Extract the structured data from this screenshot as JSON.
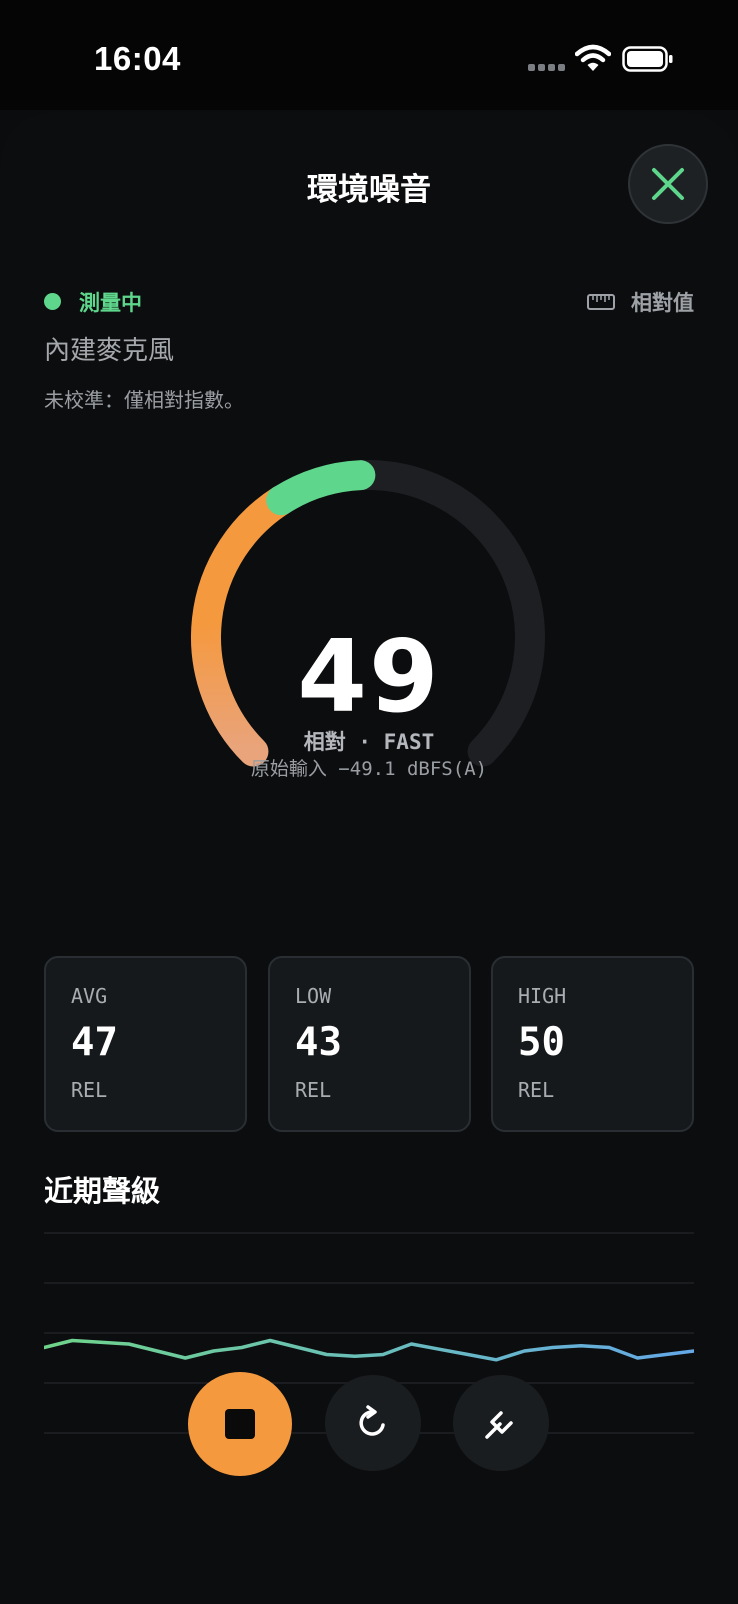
{
  "status_bar": {
    "time": "16:04"
  },
  "sheet": {
    "title": "環境噪音",
    "close_icon": "close-x-icon"
  },
  "measurement": {
    "status": "測量中",
    "status_color": "#5ed68b",
    "unit_mode": "相對值",
    "device": "內建麥克風",
    "calibration_note": "未校準：僅相對指數。"
  },
  "gauge": {
    "value": "49",
    "mode": "相對 · FAST",
    "raw_input": "原始輸入 −49.1 dBFS(A)",
    "level_fraction": 0.49,
    "colors": {
      "track": "#1d1f22",
      "orange": "#f5993f",
      "green": "#5ed68b"
    }
  },
  "stats": [
    {
      "label": "AVG",
      "value": "47",
      "unit": "REL"
    },
    {
      "label": "LOW",
      "value": "43",
      "unit": "REL"
    },
    {
      "label": "HIGH",
      "value": "50",
      "unit": "REL"
    }
  ],
  "recent": {
    "title": "近期聲級",
    "levels": [
      47,
      49,
      48.5,
      48,
      46,
      44,
      46,
      47,
      49,
      47,
      45,
      44.5,
      45,
      48,
      46.5,
      45,
      43.5,
      46,
      47,
      47.5,
      47,
      44,
      45,
      46
    ],
    "y_range": [
      20,
      80
    ],
    "colors": {
      "start": "#6fd48a",
      "end": "#64a8e8",
      "grid": "#1f2226"
    }
  },
  "controls": [
    {
      "name": "stop",
      "icon": "stop-square-icon",
      "color": "#f5993f"
    },
    {
      "name": "reset",
      "icon": "reset-arrow-icon"
    },
    {
      "name": "tune",
      "icon": "tuning-fork-icon"
    }
  ]
}
